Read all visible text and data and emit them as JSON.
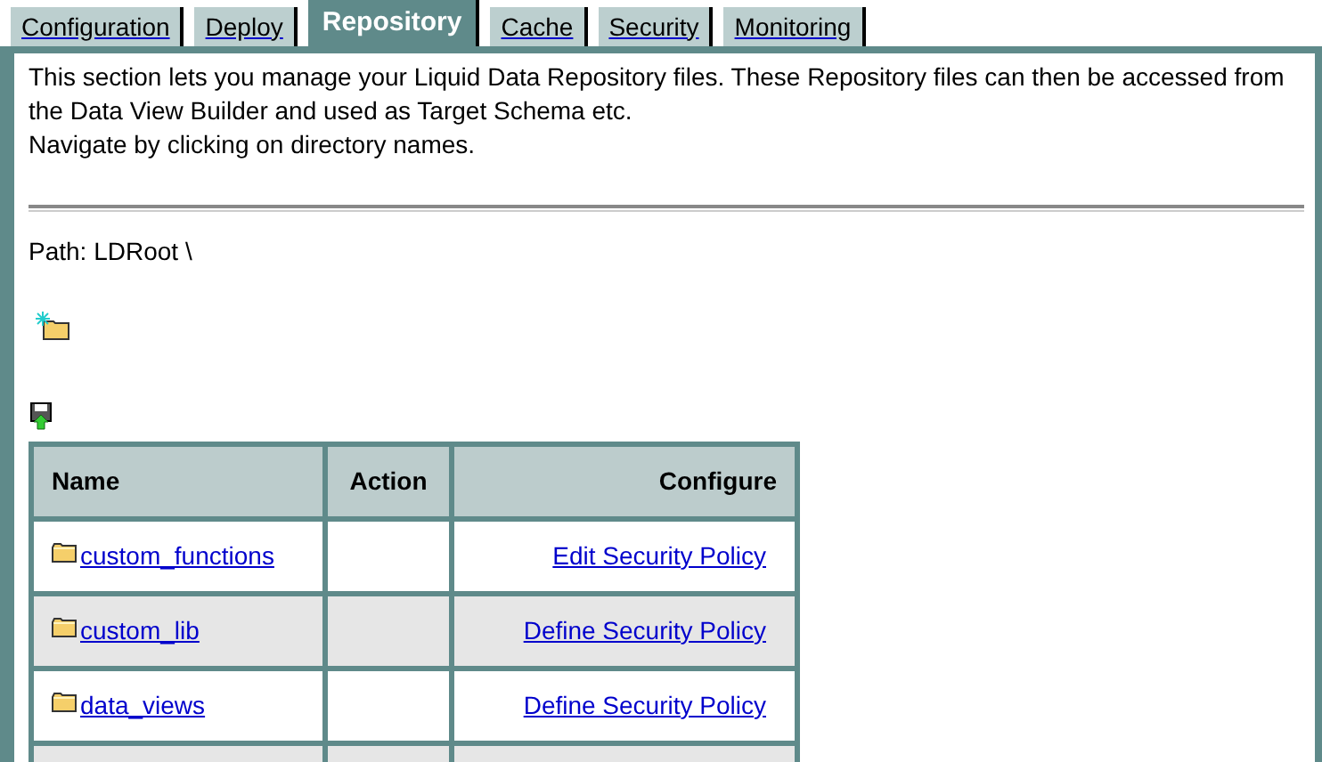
{
  "tabs": [
    {
      "label": "Configuration",
      "selected": false
    },
    {
      "label": "Deploy",
      "selected": false
    },
    {
      "label": "Repository",
      "selected": true
    },
    {
      "label": "Cache",
      "selected": false
    },
    {
      "label": "Security",
      "selected": false
    },
    {
      "label": "Monitoring",
      "selected": false
    }
  ],
  "intro": [
    "This section lets you manage your Liquid Data Repository files. These Repository files can then be accessed from the Data View Builder and used as Target Schema etc.",
    "Navigate by clicking on directory names."
  ],
  "path": "Path: LDRoot \\",
  "table": {
    "columns": [
      "Name",
      "Action",
      "Configure"
    ],
    "rows": [
      {
        "name": "custom_functions",
        "configure": "Edit Security Policy"
      },
      {
        "name": "custom_lib",
        "configure": "Define Security Policy"
      },
      {
        "name": "data_views",
        "configure": "Define Security Policy"
      }
    ]
  }
}
